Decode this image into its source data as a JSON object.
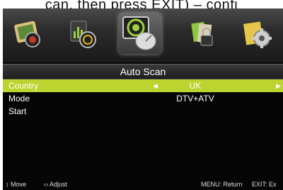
{
  "caption": "can, then press EXIT) – confi",
  "icons": [
    {
      "name": "picture-icon"
    },
    {
      "name": "sound-icon"
    },
    {
      "name": "channel-icon"
    },
    {
      "name": "lock-icon"
    },
    {
      "name": "setup-icon"
    }
  ],
  "title": "Auto Scan",
  "menu": {
    "country": {
      "label": "Country",
      "value": "UK"
    },
    "mode": {
      "label": "Mode",
      "value": "DTV+ATV"
    },
    "start": {
      "label": "Start"
    }
  },
  "footer": {
    "move": "↕ Move",
    "adjust": "‹› Adjust",
    "menu_return": "MENU: Return",
    "exit": "EXIT: Ex"
  },
  "colors": {
    "selected_row": "#bcd430",
    "background": "#050505"
  }
}
